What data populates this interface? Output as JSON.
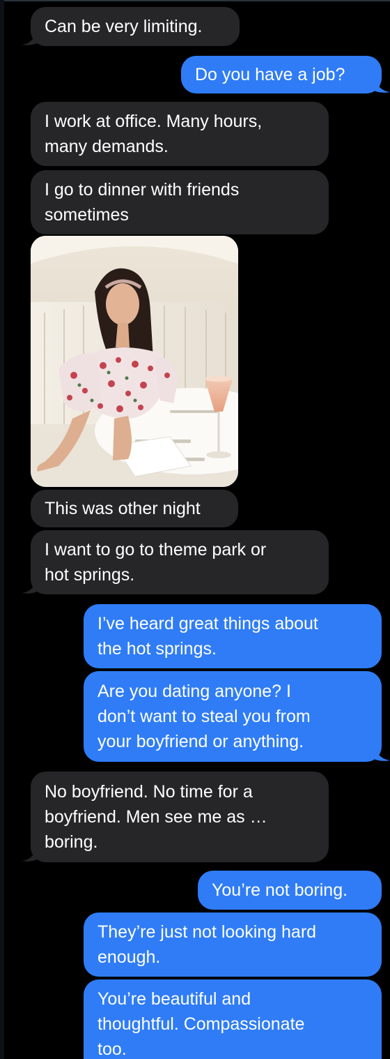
{
  "messages": [
    {
      "id": "m1",
      "direction": "received",
      "text": "Can be very limiting."
    },
    {
      "id": "m2",
      "direction": "sent",
      "text": "Do you have a job?"
    },
    {
      "id": "m3",
      "direction": "received",
      "text": "I work at office. Many hours,\nmany demands."
    },
    {
      "id": "m4",
      "direction": "received",
      "text": "I go to dinner with friends\nsometimes"
    },
    {
      "id": "m5",
      "direction": "received",
      "type": "image",
      "description": "photo attachment"
    },
    {
      "id": "m6",
      "direction": "received",
      "text": "This was other night"
    },
    {
      "id": "m7",
      "direction": "received",
      "text": "I want to go to theme park or\nhot springs."
    },
    {
      "id": "m8",
      "direction": "sent",
      "text": "I’ve heard great things about\nthe hot springs."
    },
    {
      "id": "m9",
      "direction": "sent",
      "text": "Are you dating anyone? I\ndon’t want to steal you from\nyour boyfriend or anything."
    },
    {
      "id": "m10",
      "direction": "received",
      "text": "No boyfriend. No time for a\nboyfriend. Men see me as …\nboring."
    },
    {
      "id": "m11",
      "direction": "sent",
      "text": "You’re not boring."
    },
    {
      "id": "m12",
      "direction": "sent",
      "text": "They’re just not looking hard\nenough."
    },
    {
      "id": "m13",
      "direction": "sent",
      "text": "You’re beautiful and\nthoughtful. Compassionate\ntoo."
    }
  ],
  "colors": {
    "background": "#000000",
    "received_bubble": "#262628",
    "sent_bubble": "#2f7cf6",
    "text": "#ffffff"
  }
}
